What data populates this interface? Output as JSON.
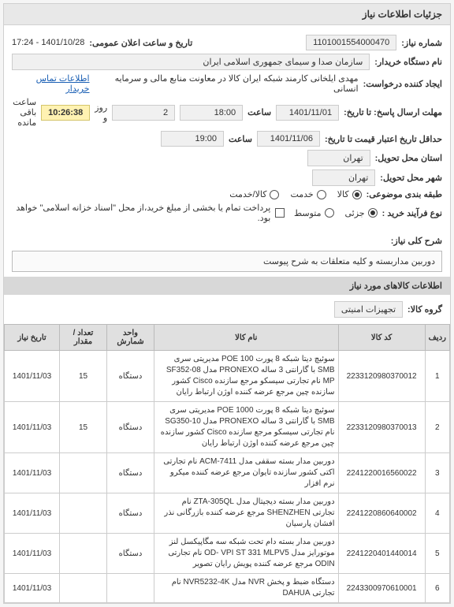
{
  "panel_title": "جزئیات اطلاعات نیاز",
  "fields": {
    "need_no_label": "شماره نیاز:",
    "need_no": "1101001554000470",
    "announce_label": "تاریخ و ساعت اعلان عمومی:",
    "announce": "1401/10/28 - 17:24",
    "buyer_label": "نام دستگاه خریدار:",
    "buyer": "سازمان صدا و سیمای جمهوری اسلامی ایران",
    "creator_label": "ایجاد کننده درخواست:",
    "creator": "مهدی ایلخانی کارمند شبکه ایران کالا در معاونت منابع مالی و سرمایه انسانی",
    "contact_link": "اطلاعات تماس خریدار",
    "deadline_label": "مهلت ارسال پاسخ: تا تاریخ:",
    "deadline_date": "1401/11/01",
    "time_label": "ساعت",
    "deadline_time": "18:00",
    "days": "2",
    "days_label": "روز و",
    "countdown": "10:26:38",
    "remaining_label": "ساعت باقی مانده",
    "validity_label": "حداقل تاریخ اعتبار قیمت تا تاریخ:",
    "validity_date": "1401/11/06",
    "validity_time": "19:00",
    "province_label": "استان محل تحویل:",
    "province": "تهران",
    "city_label": "شهر محل تحویل:",
    "city": "تهران",
    "category_label": "طبقه بندی موضوعی:",
    "cat_goods": "کالا",
    "cat_service": "خدمت",
    "cat_goods_service": "کالا/خدمت",
    "process_label": "نوع فرآیند خرید :",
    "proc_partial": "جزئی",
    "proc_medium": "متوسط",
    "payment_note": "پرداخت تمام یا بخشی از مبلغ خرید،از محل \"اسناد خزانه اسلامی\" خواهد بود.",
    "desc_label": "شرح کلی نیاز:",
    "desc": "دوربین مداربسته و کلیه متعلقات به شرح پیوست",
    "items_header": "اطلاعات کالاهای مورد نیاز",
    "group_label": "گروه کالا:",
    "group": "تجهیزات امنیتی"
  },
  "table": {
    "headers": {
      "row": "ردیف",
      "code": "کد کالا",
      "name": "نام کالا",
      "unit": "واحد شمارش",
      "qty": "تعداد / مقدار",
      "date": "تاریخ نیاز"
    },
    "rows": [
      {
        "n": "1",
        "code": "2233120980370012",
        "name": "سوئیچ دیتا شبکه 8 پورت POE 100 مدیریتی سری SMB با گارانتی 3 ساله PRONEXO مدل SF352-08 MP نام تجارتی سیسکو مرجع سازنده Cisco کشور سازنده چین مرجع عرضه کننده اوژن ارتباط رایان",
        "unit": "دستگاه",
        "qty": "15",
        "date": "1401/11/03"
      },
      {
        "n": "2",
        "code": "2233120980370013",
        "name": "سوئیچ دیتا شبکه 8 پورت POE 1000 مدیریتی سری SMB با گارانتی 3 ساله PRONEXO مدل SG350-10 نام تجارتی سیسکو مرجع سازنده Cisco کشور سازنده چین مرجع عرضه کننده اوژن ارتباط رایان",
        "unit": "دستگاه",
        "qty": "15",
        "date": "1401/11/03"
      },
      {
        "n": "3",
        "code": "2241220016560022",
        "name": "دوربین مدار بسته سقفی مدل ACM-7411 نام تجارتی اکتی کشور سازنده تایوان مرجع عرضه کننده میکرو نرم افزار",
        "unit": "دستگاه",
        "qty": "",
        "date": "1401/11/03"
      },
      {
        "n": "4",
        "code": "2241220860640002",
        "name": "دوربین مدار بسته دیجیتال مدل ZTA-305QL نام تجارتی SHENZHEN مرجع عرضه کننده بازرگانی نذر افشان پارسیان",
        "unit": "دستگاه",
        "qty": "",
        "date": "1401/11/03"
      },
      {
        "n": "5",
        "code": "2241220401440014",
        "name": "دوربین مدار بسته دام تحت شبکه سه مگاپیکسل لنز موتورایز مدل OD- VPI ST 331 MLPV5 نام تجارتی ODIN مرجع عرضه کننده پویش رایان تصویر",
        "unit": "دستگاه",
        "qty": "",
        "date": "1401/11/03"
      },
      {
        "n": "6",
        "code": "2243300970610001",
        "name": "دستگاه ضبط و پخش NVR مدل NVR5232-4K نام تجارتی DAHUA",
        "unit": "",
        "qty": "",
        "date": "1401/11/03"
      }
    ]
  }
}
